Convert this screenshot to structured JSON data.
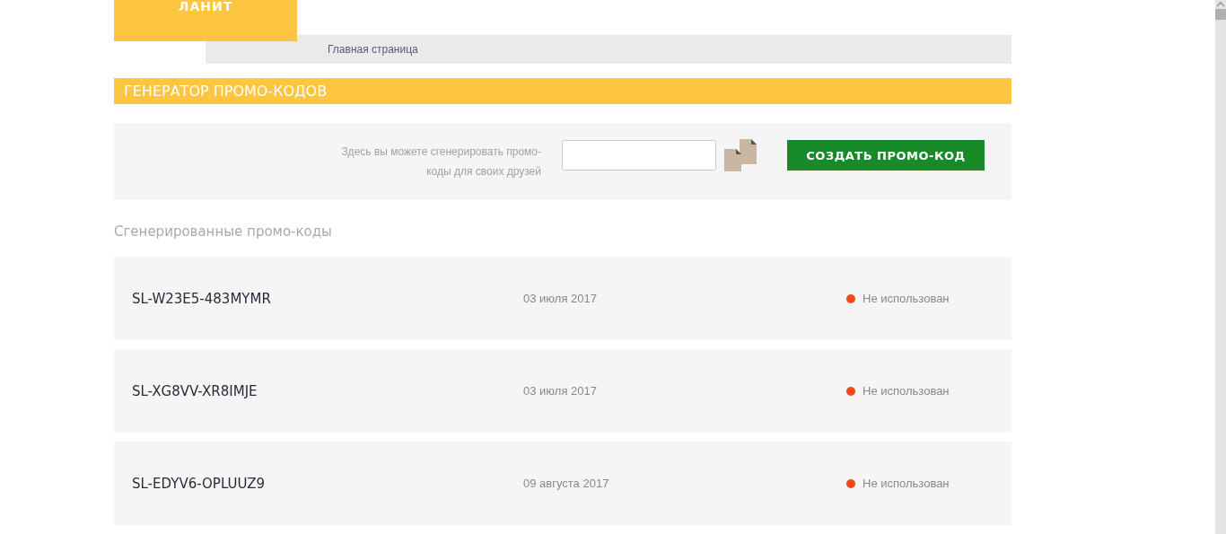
{
  "logo": {
    "text": "ЛАНИТ"
  },
  "breadcrumb": {
    "label": "Главная страница"
  },
  "section_title": "ГЕНЕРАТОР ПРОМО-КОДОВ",
  "generator": {
    "description": "Здесь вы можете сгенерировать промо-коды для своих друзей",
    "button": "СОЗДАТЬ ПРОМО-КОД"
  },
  "list_heading": "Сгенерированные промо-коды",
  "codes": [
    {
      "code": "SL-W23E5-483MYMR",
      "date": "03 июля 2017",
      "status": "Не использован",
      "color": "#f04a1c"
    },
    {
      "code": "SL-XG8VV-XR8IMJE",
      "date": "03 июля 2017",
      "status": "Не использован",
      "color": "#f04a1c"
    },
    {
      "code": "SL-EDYV6-OPLUUZ9",
      "date": "09 августа 2017",
      "status": "Не использован",
      "color": "#f04a1c"
    }
  ]
}
